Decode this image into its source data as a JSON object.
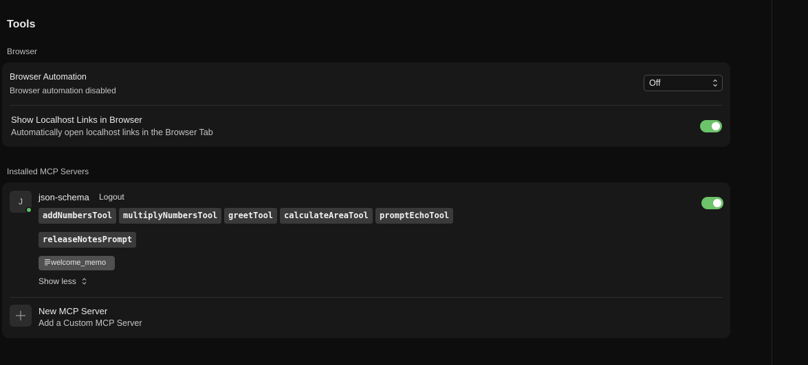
{
  "page": {
    "title": "Tools"
  },
  "browser_section": {
    "label": "Browser",
    "automation": {
      "title": "Browser Automation",
      "subtitle": "Browser automation disabled",
      "select_value": "Off"
    },
    "localhost": {
      "title": "Show Localhost Links in Browser",
      "subtitle": "Automatically open localhost links in the Browser Tab",
      "enabled": true
    }
  },
  "mcp_section": {
    "label": "Installed MCP Servers",
    "server": {
      "avatar_letter": "J",
      "name": "json-schema",
      "logout_label": "Logout",
      "enabled": true,
      "tools": [
        "addNumbersTool",
        "multiplyNumbersTool",
        "greetTool",
        "calculateAreaTool",
        "promptEchoTool",
        "releaseNotesPrompt"
      ],
      "resource": "welcome_memo",
      "show_less_label": "Show less"
    },
    "new_server": {
      "title": "New MCP Server",
      "subtitle": "Add a Custom MCP Server"
    }
  },
  "colors": {
    "toggle_on": "#6cc36a",
    "status_online": "#5fbf63"
  }
}
